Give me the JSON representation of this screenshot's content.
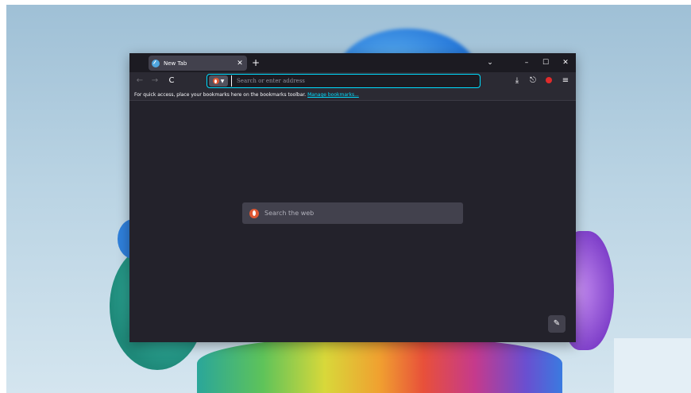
{
  "browser": {
    "tab": {
      "title": "New Tab",
      "close": "✕"
    },
    "new_tab": "+",
    "tabs_list": "⌄",
    "window_controls": {
      "minimize": "–",
      "maximize": "☐",
      "close": "✕"
    },
    "nav": {
      "back": "←",
      "forward": "→",
      "reload": "C"
    },
    "urlbar": {
      "placeholder": "Search or enter address",
      "value": ""
    },
    "toolbar": {
      "downloads": "⤓",
      "share": "⎋",
      "menu": "≡"
    },
    "bookmarks": {
      "message": "For quick access, place your bookmarks here on the bookmarks toolbar.",
      "link": "Manage bookmarks..."
    },
    "new_tab_page": {
      "search_placeholder": "Search the web",
      "edit_icon": "✎"
    }
  },
  "colors": {
    "frame": "#1c1b22",
    "toolbar": "#2b2a33",
    "content": "#23222b",
    "accent": "#00ddff",
    "search_engine": "#de5833"
  }
}
